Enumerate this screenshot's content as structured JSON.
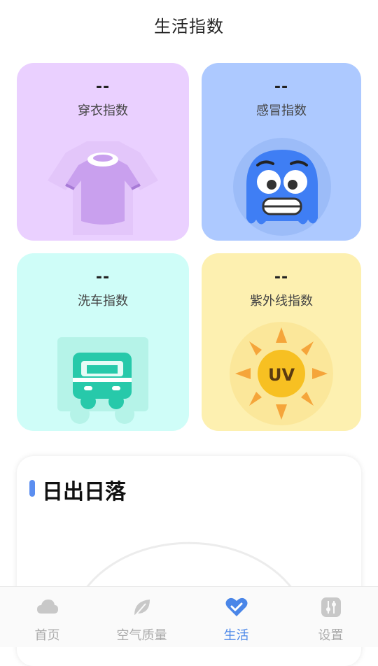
{
  "header": {
    "title": "生活指数"
  },
  "cards": [
    {
      "value": "--",
      "label": "穿衣指数",
      "icon": "shirt-icon"
    },
    {
      "value": "--",
      "label": "感冒指数",
      "icon": "cold-face-icon"
    },
    {
      "value": "--",
      "label": "洗车指数",
      "icon": "car-icon"
    },
    {
      "value": "--",
      "label": "紫外线指数",
      "icon": "uv-sun-icon",
      "icon_text": "UV"
    }
  ],
  "sunrise": {
    "title": "日出日落"
  },
  "tabs": [
    {
      "label": "首页",
      "icon": "cloud-icon"
    },
    {
      "label": "空气质量",
      "icon": "leaf-icon"
    },
    {
      "label": "生活",
      "icon": "heart-check-icon",
      "active": true
    },
    {
      "label": "设置",
      "icon": "sliders-icon"
    }
  ],
  "colors": {
    "accent": "#4a86e8",
    "card_dress": "#ead0ff",
    "card_cold": "#adc9ff",
    "card_carwash": "#cffdf8",
    "card_uv": "#fdf0b0"
  }
}
